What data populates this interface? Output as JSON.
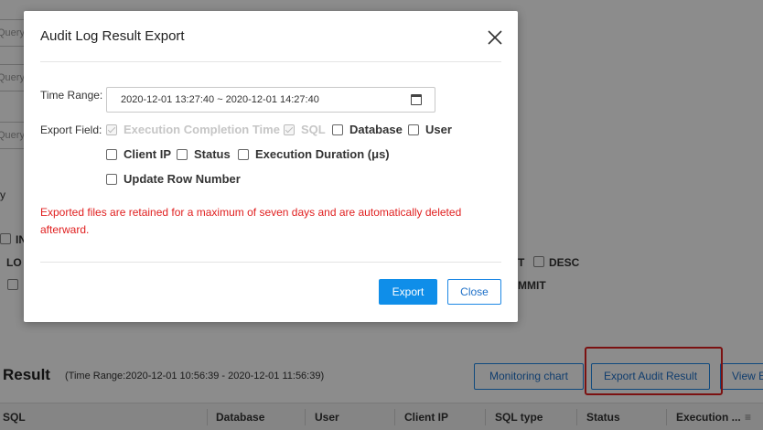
{
  "background": {
    "query_placeholder": "Query by",
    "filters": {
      "label_y": "y",
      "opt_in": "IN",
      "opt_loc": "LO",
      "opt_t": "T",
      "opt_desc": "DESC",
      "opt_commit": "MMIT"
    },
    "result": {
      "title": "Result",
      "time_range": "(Time Range:2020-12-01 10:56:39 - 2020-12-01 11:56:39)",
      "monitoring_chart_label": "Monitoring chart",
      "export_audit_result_label": "Export Audit Result",
      "view_label": "View E",
      "highlight_color": "#e02020"
    },
    "table_headers": [
      "SQL",
      "Database",
      "User",
      "Client IP",
      "SQL type",
      "Status",
      "Execution ..."
    ]
  },
  "modal": {
    "title": "Audit Log Result Export",
    "close_icon": "close-icon",
    "time_range_label": "Time Range:",
    "time_range_value": "2020-12-01 13:27:40 ~ 2020-12-01 14:27:40",
    "calendar_icon": "calendar-icon",
    "export_field_label": "Export Field:",
    "fields": [
      {
        "label": "Execution Completion Time",
        "checked": true,
        "disabled": true
      },
      {
        "label": "SQL",
        "checked": true,
        "disabled": true
      },
      {
        "label": "Database",
        "checked": false,
        "disabled": false
      },
      {
        "label": "User",
        "checked": false,
        "disabled": false
      },
      {
        "label": "Client IP",
        "checked": false,
        "disabled": false
      },
      {
        "label": "Status",
        "checked": false,
        "disabled": false
      },
      {
        "label": "Execution Duration (μs)",
        "checked": false,
        "disabled": false
      },
      {
        "label": "Update Row Number",
        "checked": false,
        "disabled": false
      }
    ],
    "warning": "Exported files are retained for a maximum of seven days and are automatically deleted afterward.",
    "export_button": "Export",
    "close_button": "Close",
    "colors": {
      "primary": "#0f8ee9",
      "warning": "#e02020"
    }
  }
}
